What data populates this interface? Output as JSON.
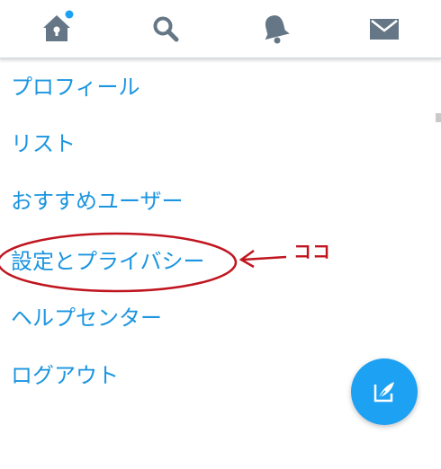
{
  "tab_bar": {
    "tabs": [
      {
        "id": "home",
        "icon": "home-icon",
        "has_badge": true
      },
      {
        "id": "search",
        "icon": "search-icon"
      },
      {
        "id": "notifications",
        "icon": "bell-icon"
      },
      {
        "id": "messages",
        "icon": "envelope-icon"
      }
    ],
    "icon_color": "#657786",
    "badge_color": "#1da1f2"
  },
  "menu": {
    "items": [
      {
        "label": "プロフィール"
      },
      {
        "label": "リスト"
      },
      {
        "label": "おすすめユーザー"
      },
      {
        "label": "設定とプライバシー",
        "highlighted": true
      },
      {
        "label": "ヘルプセンター"
      },
      {
        "label": "ログアウト"
      }
    ],
    "text_color": "#1b95e0"
  },
  "annotation": {
    "label": "ココ",
    "color": "#c0151f"
  },
  "fab": {
    "icon": "compose-icon",
    "color": "#1da1f2"
  }
}
